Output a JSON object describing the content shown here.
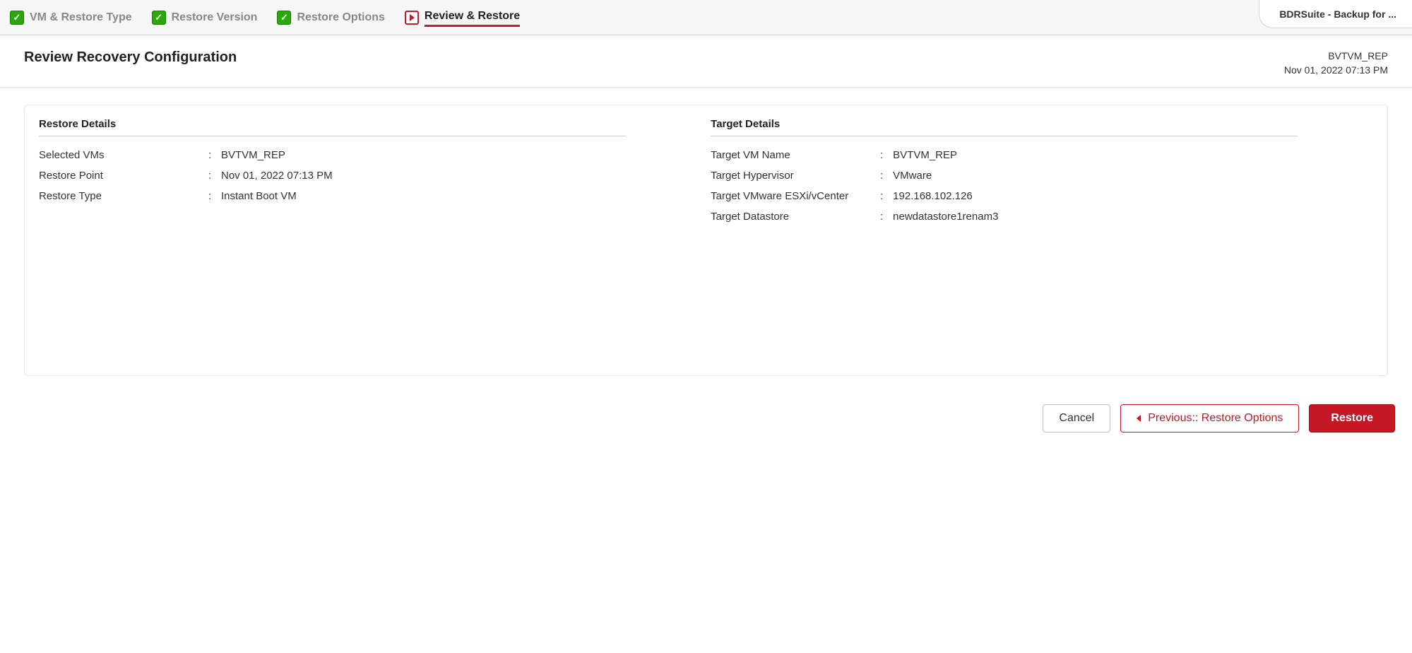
{
  "product_tab": "BDRSuite - Backup for ...",
  "wizard": {
    "steps": [
      {
        "label": "VM & Restore Type",
        "state": "done"
      },
      {
        "label": "Restore Version",
        "state": "done"
      },
      {
        "label": "Restore Options",
        "state": "done"
      },
      {
        "label": "Review & Restore",
        "state": "current"
      }
    ]
  },
  "page": {
    "title": "Review Recovery Configuration",
    "context_name": "BVTVM_REP",
    "context_time": "Nov 01, 2022 07:13 PM"
  },
  "restore_details": {
    "header": "Restore Details",
    "rows": [
      {
        "label": "Selected VMs",
        "value": "BVTVM_REP"
      },
      {
        "label": "Restore Point",
        "value": "Nov 01, 2022 07:13 PM"
      },
      {
        "label": "Restore Type",
        "value": "Instant Boot VM"
      }
    ]
  },
  "target_details": {
    "header": "Target Details",
    "rows": [
      {
        "label": "Target VM Name",
        "value": "BVTVM_REP"
      },
      {
        "label": "Target Hypervisor",
        "value": "VMware"
      },
      {
        "label": "Target VMware ESXi/vCenter",
        "value": "192.168.102.126"
      },
      {
        "label": "Target Datastore",
        "value": "newdatastore1renam3"
      }
    ]
  },
  "footer": {
    "cancel": "Cancel",
    "previous": "Previous:: Restore Options",
    "restore": "Restore"
  }
}
